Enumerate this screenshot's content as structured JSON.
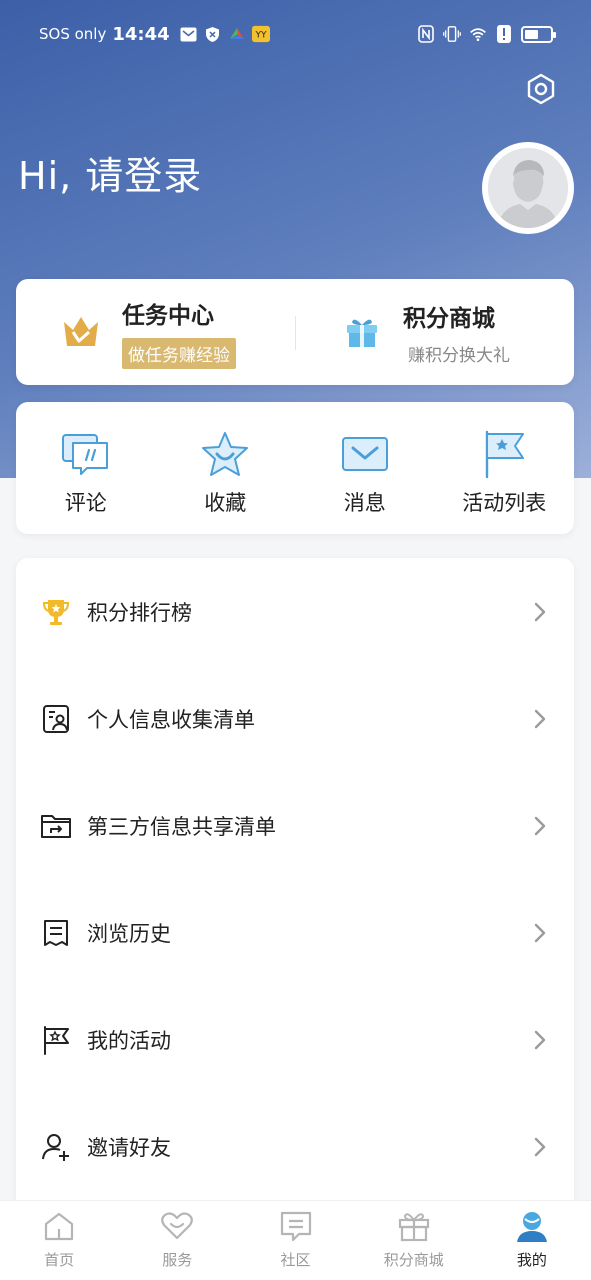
{
  "status_bar": {
    "carrier": "SOS only",
    "time": "14:44",
    "battery_level": 0.55
  },
  "header": {
    "greeting": "Hi, 请登录"
  },
  "promo": [
    {
      "title": "任务中心",
      "subtitle": "做任务赚经验",
      "icon": "crown-icon"
    },
    {
      "title": "积分商城",
      "subtitle": "赚积分换大礼",
      "icon": "gift-icon"
    }
  ],
  "quick_actions": [
    {
      "label": "评论",
      "icon": "comment-icon"
    },
    {
      "label": "收藏",
      "icon": "star-icon"
    },
    {
      "label": "消息",
      "icon": "message-icon"
    },
    {
      "label": "活动列表",
      "icon": "flag-icon"
    }
  ],
  "menu": [
    {
      "label": "积分排行榜",
      "icon": "trophy-icon"
    },
    {
      "label": "个人信息收集清单",
      "icon": "personal-info-icon"
    },
    {
      "label": "第三方信息共享清单",
      "icon": "folder-share-icon"
    },
    {
      "label": "浏览历史",
      "icon": "history-icon"
    },
    {
      "label": "我的活动",
      "icon": "activity-flag-icon"
    },
    {
      "label": "邀请好友",
      "icon": "invite-user-icon"
    }
  ],
  "tabs": [
    {
      "label": "首页",
      "icon": "home-icon",
      "active": false
    },
    {
      "label": "服务",
      "icon": "service-heart-icon",
      "active": false
    },
    {
      "label": "社区",
      "icon": "community-icon",
      "active": false
    },
    {
      "label": "积分商城",
      "icon": "gift-icon",
      "active": false
    },
    {
      "label": "我的",
      "icon": "profile-icon",
      "active": true
    }
  ],
  "colors": {
    "header_gradient_start": "#3c5fa8",
    "header_gradient_end": "#9db0da",
    "accent_blue": "#4a9fd8",
    "gold": "#d9b870"
  }
}
